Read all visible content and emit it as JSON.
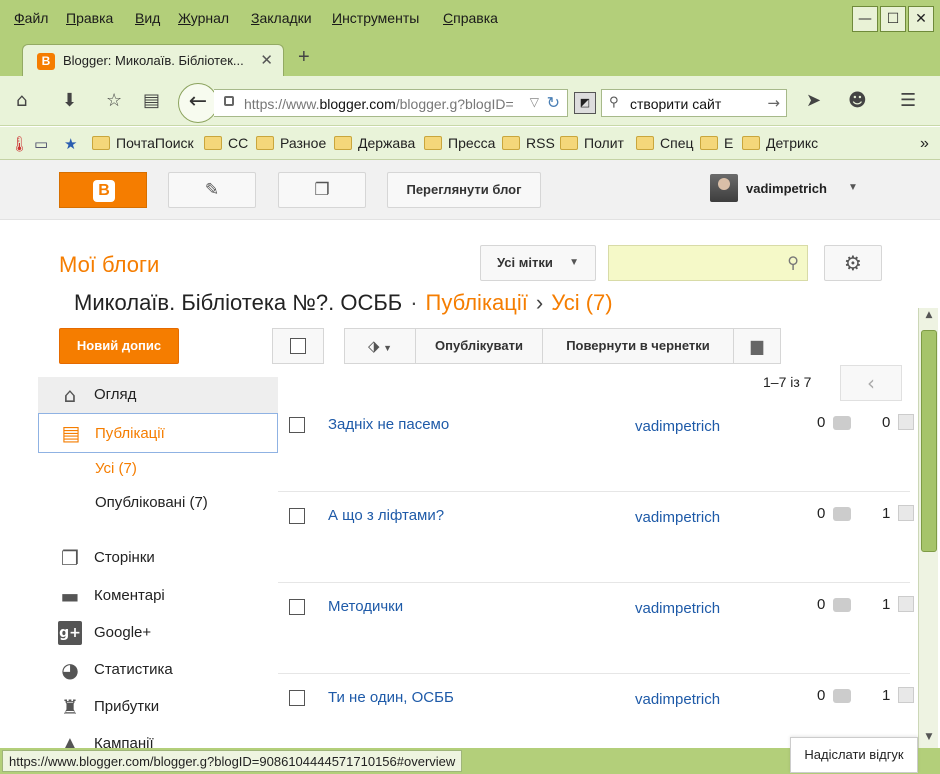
{
  "browser": {
    "menu": [
      "Файл",
      "Правка",
      "Вид",
      "Журнал",
      "Закладки",
      "Инструменты",
      "Справка"
    ],
    "window_controls": {
      "minimize": "—",
      "maximize": "☐",
      "close": "✕"
    },
    "tab": {
      "title": "Blogger: Миколаїв. Бібліотек...",
      "close": "✕",
      "favicon": "B"
    },
    "new_tab": "+",
    "url": {
      "prefix": "https://www.",
      "domain": "blogger.com",
      "path": "/blogger.g?blogID="
    },
    "search": {
      "value": "створити сайт"
    },
    "bookmarks": [
      "ПочтаПоиск",
      "CC",
      "Разное",
      "Держава",
      "Пресса",
      "RSS",
      "Полит",
      "Спец",
      "E",
      "Детрикс"
    ],
    "bookmarks_more": "»"
  },
  "topbar": {
    "view_blog": "Переглянути блог",
    "username": "vadimpetrich"
  },
  "header": {
    "my_blogs": "Мої блоги",
    "labels_button": "Усі мітки",
    "search_placeholder": ""
  },
  "breadcrumb": {
    "blog_name": "Миколаїв. Бібліотека №?. ОСББ",
    "dot": "·",
    "section": "Публікації",
    "arrow": "›",
    "filter": "Усі (7)"
  },
  "new_post_button": "Новий допис",
  "sidebar": {
    "overview": "Огляд",
    "posts": "Публікації",
    "all": "Усі (7)",
    "published": "Опубліковані (7)",
    "pages": "Сторінки",
    "comments": "Коментарі",
    "google_plus": "Google+",
    "stats": "Статистика",
    "earnings": "Прибутки",
    "campaigns": "Кампанії"
  },
  "toolbar": {
    "publish": "Опублікувати",
    "revert": "Повернути в чернетки",
    "counter": "1–7 із 7"
  },
  "posts": [
    {
      "title": "Задніх не пасемо",
      "author": "vadimpetrich",
      "comments": "0",
      "views": "0"
    },
    {
      "title": "А що з ліфтами?",
      "author": "vadimpetrich",
      "comments": "0",
      "views": "1"
    },
    {
      "title": "Методички",
      "author": "vadimpetrich",
      "comments": "0",
      "views": "1"
    },
    {
      "title": "Ти не один, ОСББ",
      "author": "vadimpetrich",
      "comments": "0",
      "views": "1"
    }
  ],
  "status": {
    "url": "https://www.blogger.com/blogger.g?blogID=9086104444571710156#overview",
    "feedback": "Надіслати відгук"
  },
  "colors": {
    "accent": "#f57d00",
    "link": "#1e5aa8",
    "chrome": "#b3cf7a"
  }
}
